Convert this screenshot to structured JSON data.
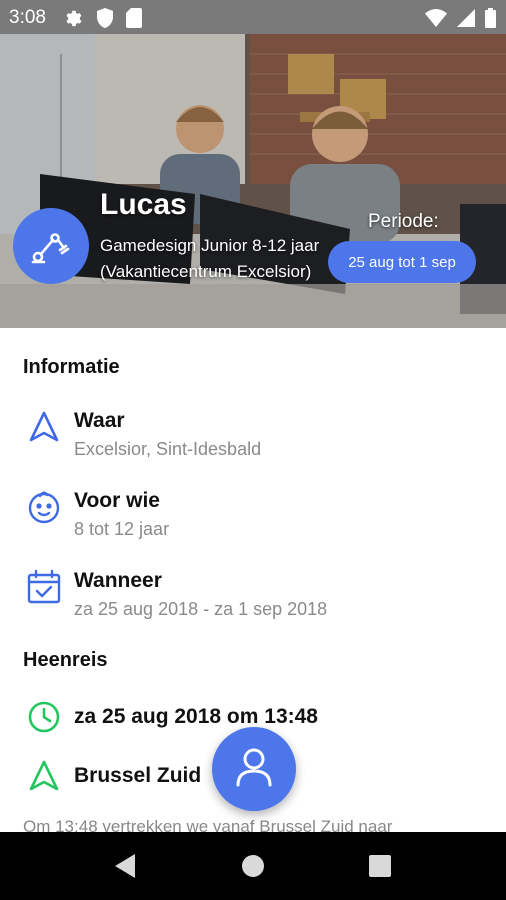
{
  "status_bar": {
    "time": "3:08",
    "left_icons": [
      "gear-icon",
      "shield-icon",
      "sd-card-icon"
    ],
    "right_icons": [
      "wifi-icon",
      "signal-icon",
      "battery-icon"
    ]
  },
  "hero": {
    "name": "Lucas",
    "course": "Gamedesign Junior 8-12 jaar (Vakantiecentrum Excelsior)",
    "period_label": "Periode:",
    "period_value": "25 aug tot 1 sep",
    "avatar_icon": "robot-arm-icon",
    "colors": {
      "accent": "#4c76ea"
    }
  },
  "info": {
    "title": "Informatie",
    "items": [
      {
        "icon": "navigation-icon",
        "title": "Waar",
        "subtitle": "Excelsior, Sint-Idesbald"
      },
      {
        "icon": "baby-face-icon",
        "title": "Voor wie",
        "subtitle": "8 tot 12 jaar"
      },
      {
        "icon": "calendar-check-icon",
        "title": "Wanneer",
        "subtitle": "za 25 aug 2018 - za 1 sep 2018"
      }
    ]
  },
  "return_trip": {
    "title": "Heenreis",
    "departure": "za 25 aug 2018 om 13:48",
    "location": "Brussel Zuid",
    "description": "Om 13:48 vertrekken we vanaf Brussel Zuid naar",
    "colors": {
      "status": "#22c55e"
    }
  },
  "fab": {
    "icon": "person-icon"
  },
  "nav_bar": {
    "buttons": [
      "back",
      "home",
      "recents"
    ]
  }
}
